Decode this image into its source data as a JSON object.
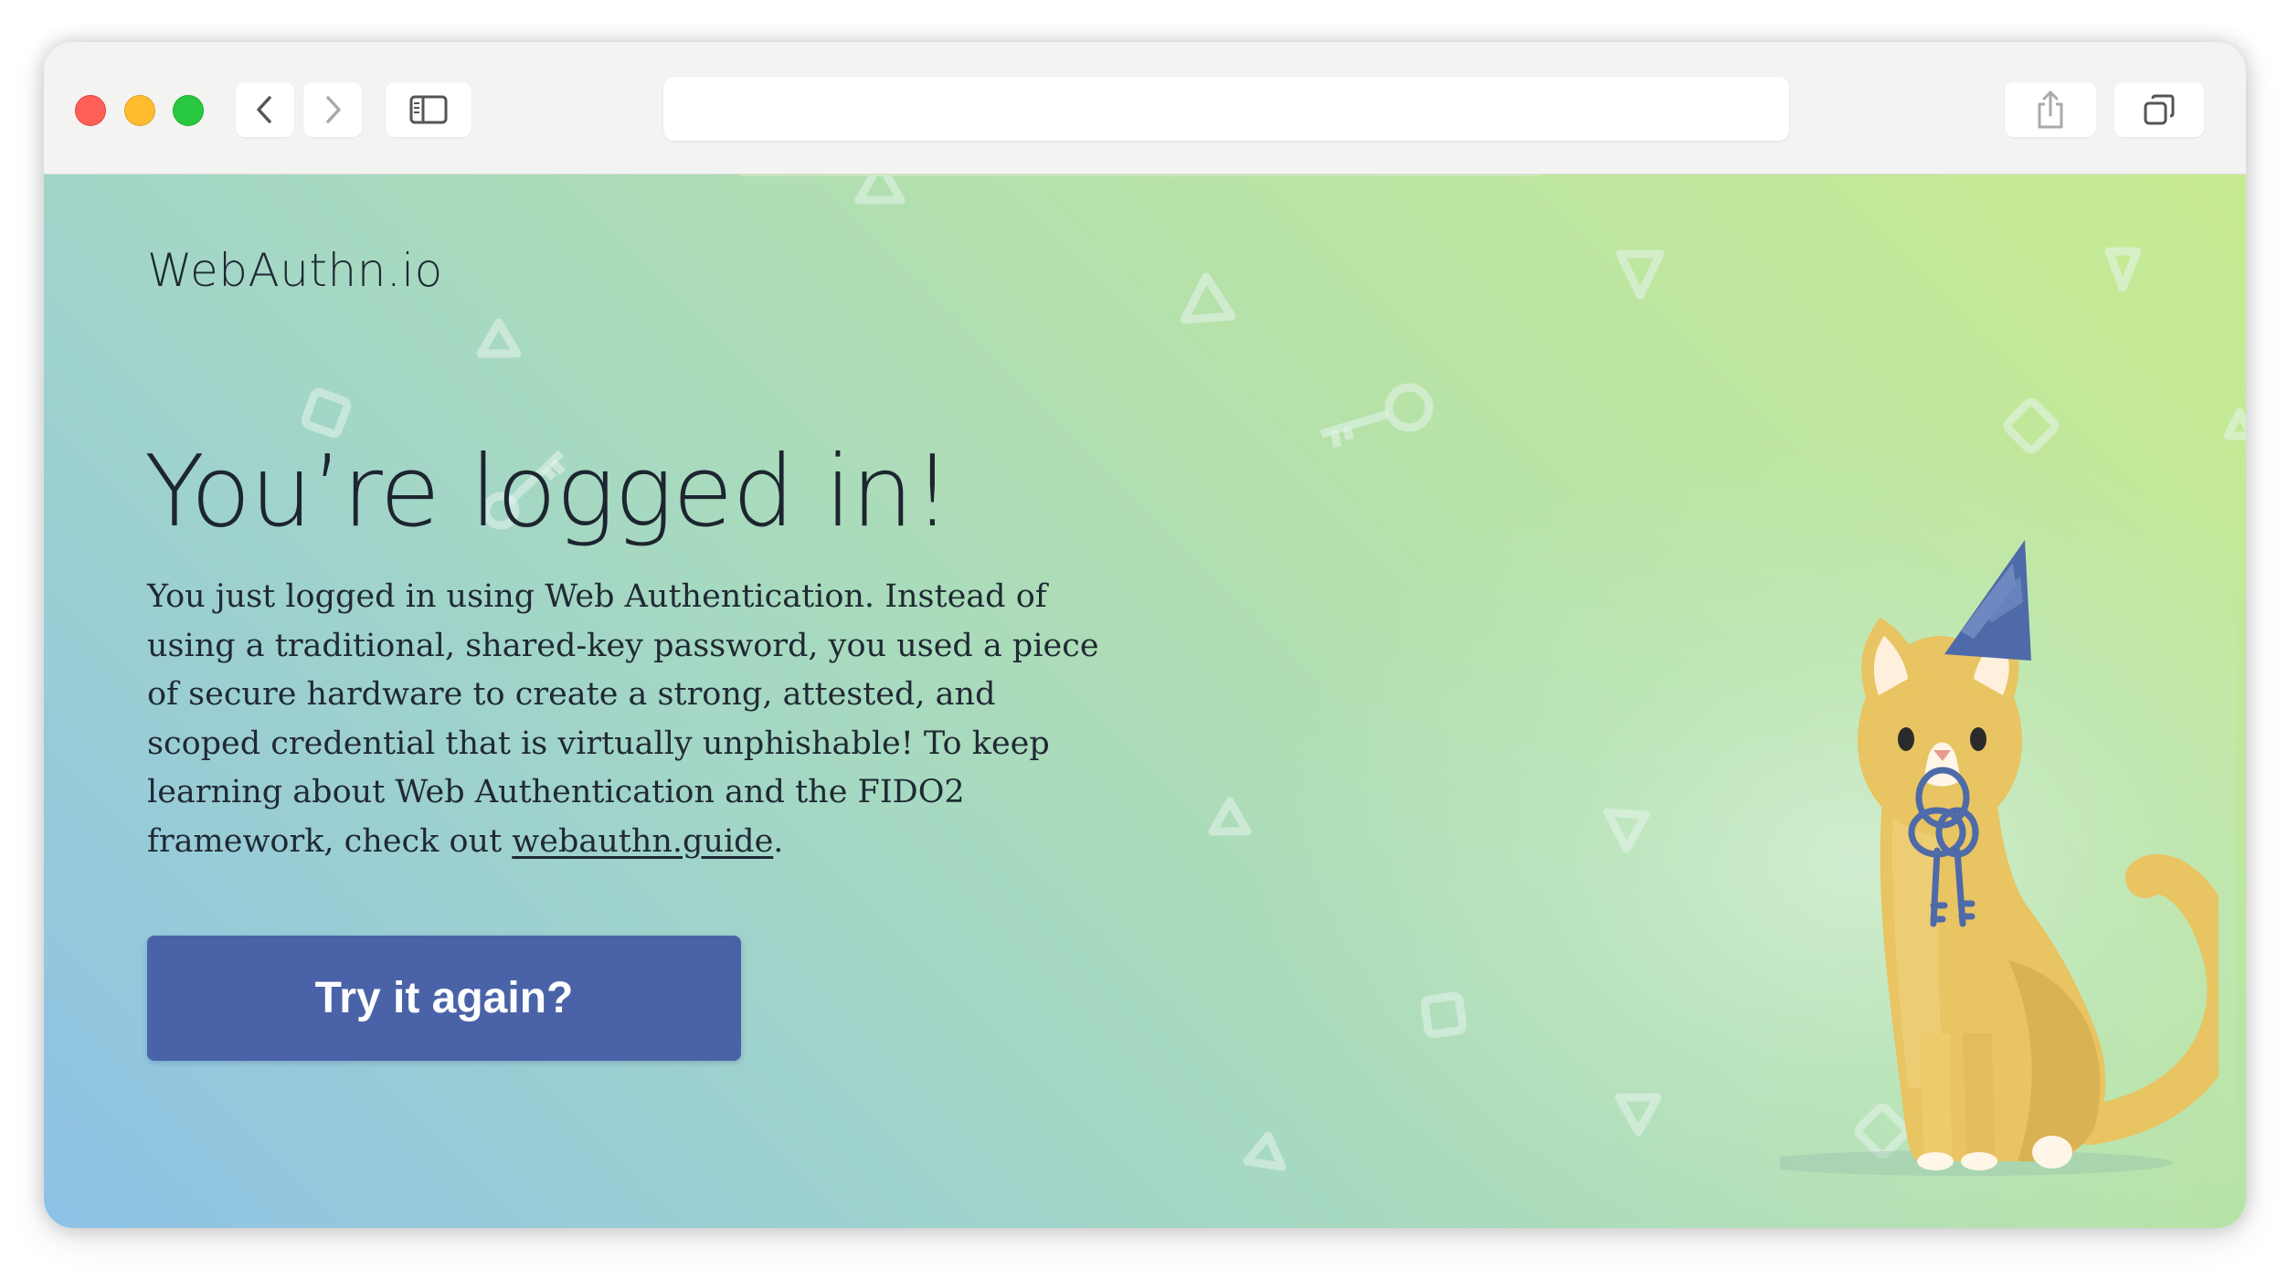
{
  "browser": {
    "address_value": "",
    "buttons": [
      "back",
      "forward",
      "sidebar",
      "share",
      "tabs"
    ]
  },
  "page": {
    "brand": "WebAuthn.io",
    "heading": "You’re logged in!",
    "body_before_link": "You just logged in using Web Authentication. Instead of using a traditional, shared-key password, you used a piece of secure hardware to create a strong, attested, and scoped credential that is virtually unphishable! To keep learning about Web Authentication and the FIDO2 framework, check out ",
    "link_text": "webauthn.guide",
    "body_after_link": ".",
    "cta_label": "Try it again?"
  },
  "colors": {
    "gradient_start": "#8dc2e6",
    "gradient_mid": "#a5d8c3",
    "gradient_end": "#c8eb91",
    "button": "#4a63a8",
    "text": "#1f2933",
    "cat_body": "#e8c462",
    "party_hat": "#4e6aa8",
    "keys": "#4e6aa8"
  },
  "illustration": {
    "subject": "cat-with-party-hat-holding-keys-icon",
    "decorations": [
      "triangle-icon",
      "square-icon",
      "key-icon"
    ]
  }
}
